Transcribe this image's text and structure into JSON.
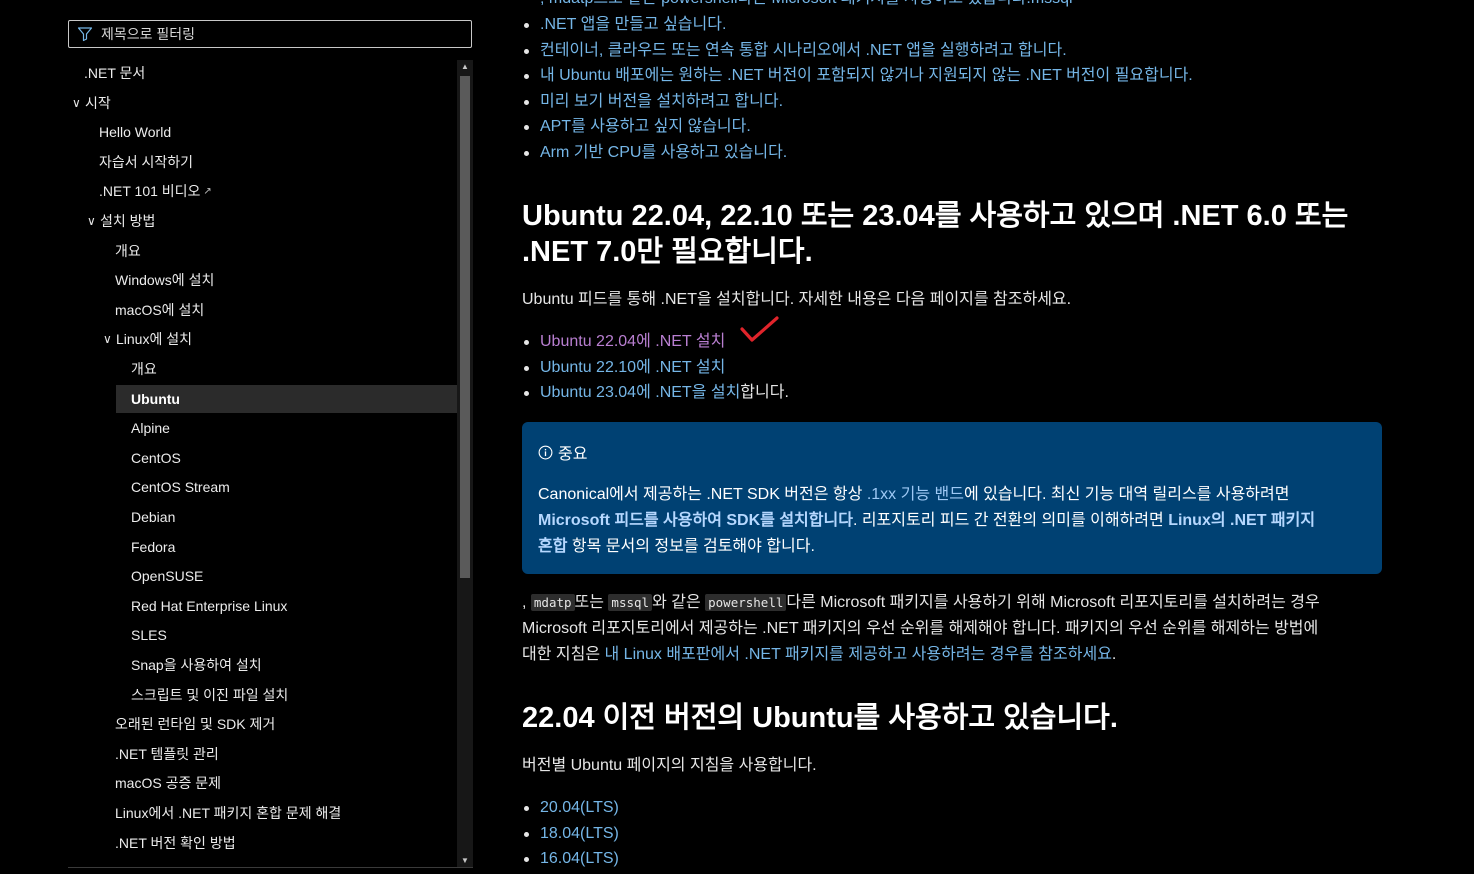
{
  "filter": {
    "placeholder": "제목으로 필터링"
  },
  "toc": [
    {
      "label": ".NET 문서",
      "level": 0,
      "expanded": null,
      "selected": false,
      "external": false
    },
    {
      "label": "시작",
      "level": 0,
      "expanded": true,
      "selected": false,
      "external": false
    },
    {
      "label": "Hello World",
      "level": 1,
      "expanded": null,
      "selected": false,
      "external": false
    },
    {
      "label": "자습서 시작하기",
      "level": 1,
      "expanded": null,
      "selected": false,
      "external": false
    },
    {
      "label": ".NET 101 비디오",
      "level": 1,
      "expanded": null,
      "selected": false,
      "external": true
    },
    {
      "label": "설치 방법",
      "level": 1,
      "expanded": true,
      "selected": false,
      "external": false
    },
    {
      "label": "개요",
      "level": 2,
      "expanded": null,
      "selected": false,
      "external": false
    },
    {
      "label": "Windows에 설치",
      "level": 2,
      "expanded": null,
      "selected": false,
      "external": false
    },
    {
      "label": "macOS에 설치",
      "level": 2,
      "expanded": null,
      "selected": false,
      "external": false
    },
    {
      "label": "Linux에 설치",
      "level": 2,
      "expanded": true,
      "selected": false,
      "external": false
    },
    {
      "label": "개요",
      "level": 3,
      "expanded": null,
      "selected": false,
      "external": false
    },
    {
      "label": "Ubuntu",
      "level": 3,
      "expanded": null,
      "selected": true,
      "external": false
    },
    {
      "label": "Alpine",
      "level": 3,
      "expanded": null,
      "selected": false,
      "external": false
    },
    {
      "label": "CentOS",
      "level": 3,
      "expanded": null,
      "selected": false,
      "external": false
    },
    {
      "label": "CentOS Stream",
      "level": 3,
      "expanded": null,
      "selected": false,
      "external": false
    },
    {
      "label": "Debian",
      "level": 3,
      "expanded": null,
      "selected": false,
      "external": false
    },
    {
      "label": "Fedora",
      "level": 3,
      "expanded": null,
      "selected": false,
      "external": false
    },
    {
      "label": "OpenSUSE",
      "level": 3,
      "expanded": null,
      "selected": false,
      "external": false
    },
    {
      "label": "Red Hat Enterprise Linux",
      "level": 3,
      "expanded": null,
      "selected": false,
      "external": false
    },
    {
      "label": "SLES",
      "level": 3,
      "expanded": null,
      "selected": false,
      "external": false
    },
    {
      "label": "Snap을 사용하여 설치",
      "level": 3,
      "expanded": null,
      "selected": false,
      "external": false
    },
    {
      "label": "스크립트 및 이진 파일 설치",
      "level": 3,
      "expanded": null,
      "selected": false,
      "external": false
    },
    {
      "label": "오래된 런타임 및 SDK 제거",
      "level": 2,
      "expanded": null,
      "selected": false,
      "external": false
    },
    {
      "label": ".NET 템플릿 관리",
      "level": 2,
      "expanded": null,
      "selected": false,
      "external": false
    },
    {
      "label": "macOS 공증 문제",
      "level": 2,
      "expanded": null,
      "selected": false,
      "external": false
    },
    {
      "label": "Linux에서 .NET 패키지 혼합 문제 해결",
      "level": 2,
      "expanded": null,
      "selected": false,
      "external": false
    },
    {
      "label": ".NET 버전 확인 방법",
      "level": 2,
      "expanded": null,
      "selected": false,
      "external": false
    }
  ],
  "main": {
    "top_partial": ", mdatp으로 같은 powershell다른 Microsoft 패키지를 사용하고 있습니다.mssql",
    "reasons": [
      ".NET 앱을 만들고 싶습니다.",
      "컨테이너, 클라우드 또는 연속 통합 시나리오에서 .NET 앱을 실행하려고 합니다.",
      "내 Ubuntu 배포에는 원하는 .NET 버전이 포함되지 않거나 지원되지 않는 .NET 버전이 필요합니다.",
      "미리 보기 버전을 설치하려고 합니다.",
      "APT를 사용하고 싶지 않습니다.",
      "Arm 기반 CPU를 사용하고 있습니다."
    ],
    "heading1_line1": "Ubuntu 22.04, 22.10 또는 23.04를 사용하고 있으며 .NET 6.0 또는",
    "heading1_line2": ".NET 7.0만 필요합니다.",
    "intro": "Ubuntu 피드를 통해 .NET을 설치합니다. 자세한 내용은 다음 페이지를 참조하세요.",
    "install_links": {
      "l1": "Ubuntu 22.04에 .NET 설치",
      "l2": "Ubuntu 22.10에 .NET 설치",
      "l3_link": "Ubuntu 23.04에 .NET을 설치",
      "l3_tail": "합니다."
    },
    "note": {
      "title": "중요",
      "t1": "Canonical에서 제공하는 .NET SDK 버전은 항상 ",
      "link1": ".1xx 기능 밴드",
      "t2": "에 있습니다. 최신 기능 대역 릴리스를 사용하려면",
      "link2": "Microsoft 피드를 사용하여 SDK를 설치합니다",
      "t3": ". 리포지토리 피드 간 전환의 의미를 이해하려면 ",
      "link3": "Linux의 .NET 패키지",
      "link4": "혼합",
      "t4": " 항목 문서의 정보를 검토해야 합니다."
    },
    "ms_para": {
      "lead": ", ",
      "code1": "mdatp",
      "t1": "또는 ",
      "code2": "mssql",
      "t2": "와 같은 ",
      "code3": "powershell",
      "t3": "다른 Microsoft 패키지를 사용하기 위해 Microsoft 리포지토리를 설치하려는 경우",
      "line2": "Microsoft 리포지토리에서 제공하는 .NET 패키지의 우선 순위를 해제해야 합니다. 패키지의 우선 순위를 해제하는 방법에",
      "line3_lead": "대한 지침은 ",
      "line3_link": "내 Linux 배포판에서 .NET 패키지를 제공하고 사용하려는 경우를 참조하세요",
      "line3_tail": "."
    },
    "heading2": "22.04 이전 버전의 Ubuntu를 사용하고 있습니다.",
    "versions_intro": "버전별 Ubuntu 페이지의 지침을 사용합니다.",
    "versions": [
      "20.04(LTS)",
      "18.04(LTS)",
      "16.04(LTS)"
    ]
  },
  "colors": {
    "link": "#75b6e7",
    "visited_link": "#b97fd1",
    "note_bg": "#004173",
    "check_mark": "#e0242b"
  }
}
